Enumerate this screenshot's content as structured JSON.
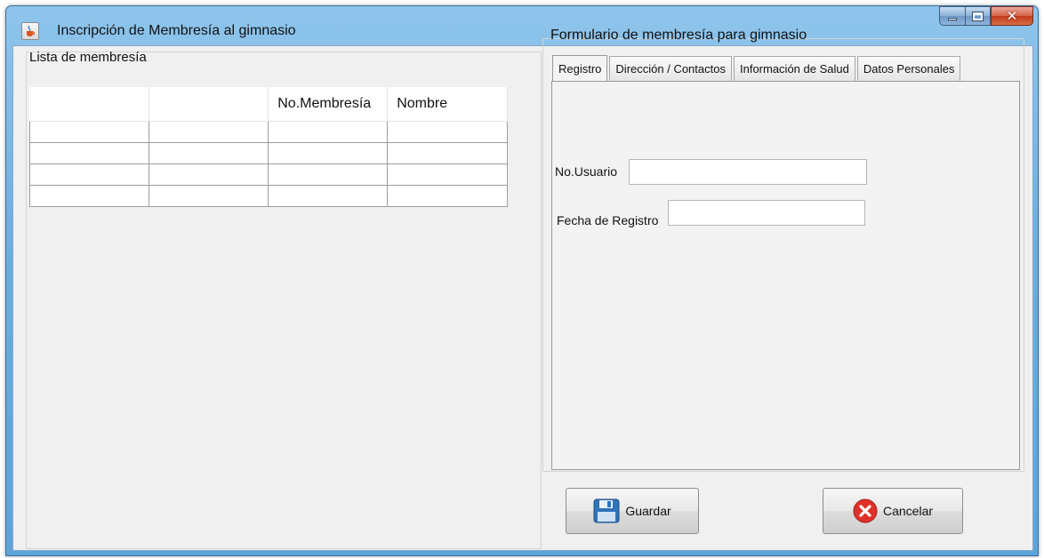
{
  "window": {
    "title": "Inscripción de Membresía al gimnasio",
    "controls": [
      "minimize-icon",
      "maximize-icon",
      "close-icon"
    ]
  },
  "left_panel": {
    "title": "Lista de membresía",
    "table": {
      "columns": [
        "",
        "",
        "No.Membresía",
        "Nombre"
      ],
      "rows": [
        [
          "",
          "",
          "",
          ""
        ],
        [
          "",
          "",
          "",
          ""
        ],
        [
          "",
          "",
          "",
          ""
        ],
        [
          "",
          "",
          "",
          ""
        ]
      ]
    }
  },
  "right_panel": {
    "title": "Formulario de membresía para gimnasio",
    "tabs": [
      {
        "label": "Registro",
        "active": true
      },
      {
        "label": "Dirección / Contactos",
        "active": false
      },
      {
        "label": "Información de Salud",
        "active": false
      },
      {
        "label": "Datos Personales",
        "active": false
      }
    ],
    "fields": {
      "usuario": {
        "label": "No.Usuario",
        "value": ""
      },
      "fecha": {
        "label": "Fecha de Registro",
        "value": ""
      }
    }
  },
  "buttons": {
    "guardar": {
      "label": "Guardar",
      "icon": "floppy-disk-icon"
    },
    "cancelar": {
      "label": "Cancelar",
      "icon": "cancel-x-icon"
    }
  },
  "colors": {
    "titlebar": "#6aaee0",
    "client_background": "#f0f0f0",
    "close_button": "#c1391c",
    "save_icon": "#2f73b8",
    "cancel_icon": "#e0302a"
  }
}
